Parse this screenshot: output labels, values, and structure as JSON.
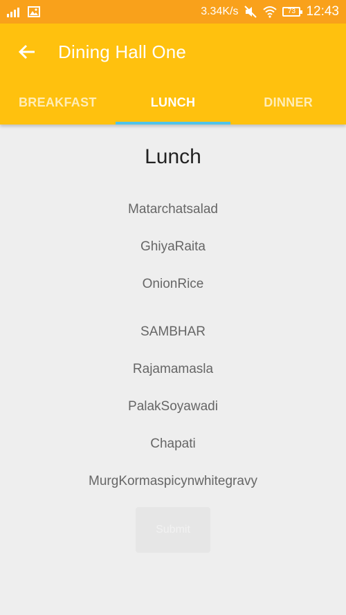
{
  "status_bar": {
    "net_speed": "3.34K/s",
    "battery": "73",
    "time": "12:43"
  },
  "toolbar": {
    "title": "Dining Hall One",
    "color": "#ffc10e"
  },
  "tabs": [
    {
      "label": "BREAKFAST",
      "active": false
    },
    {
      "label": "LUNCH",
      "active": true
    },
    {
      "label": "DINNER",
      "active": false
    }
  ],
  "colors": {
    "status_bar": "#f9a11b",
    "tab_indicator": "#4fc3e8",
    "background": "#eeeeee"
  },
  "menu": {
    "title": "Lunch",
    "items": [
      "Matarchatsalad",
      "GhiyaRaita",
      "OnionRice",
      "SAMBHAR",
      "Rajamamasla",
      "PalakSoyawadi",
      "Chapati",
      "MurgKormaspicynwhitegravy"
    ],
    "button_label": "Submit"
  }
}
